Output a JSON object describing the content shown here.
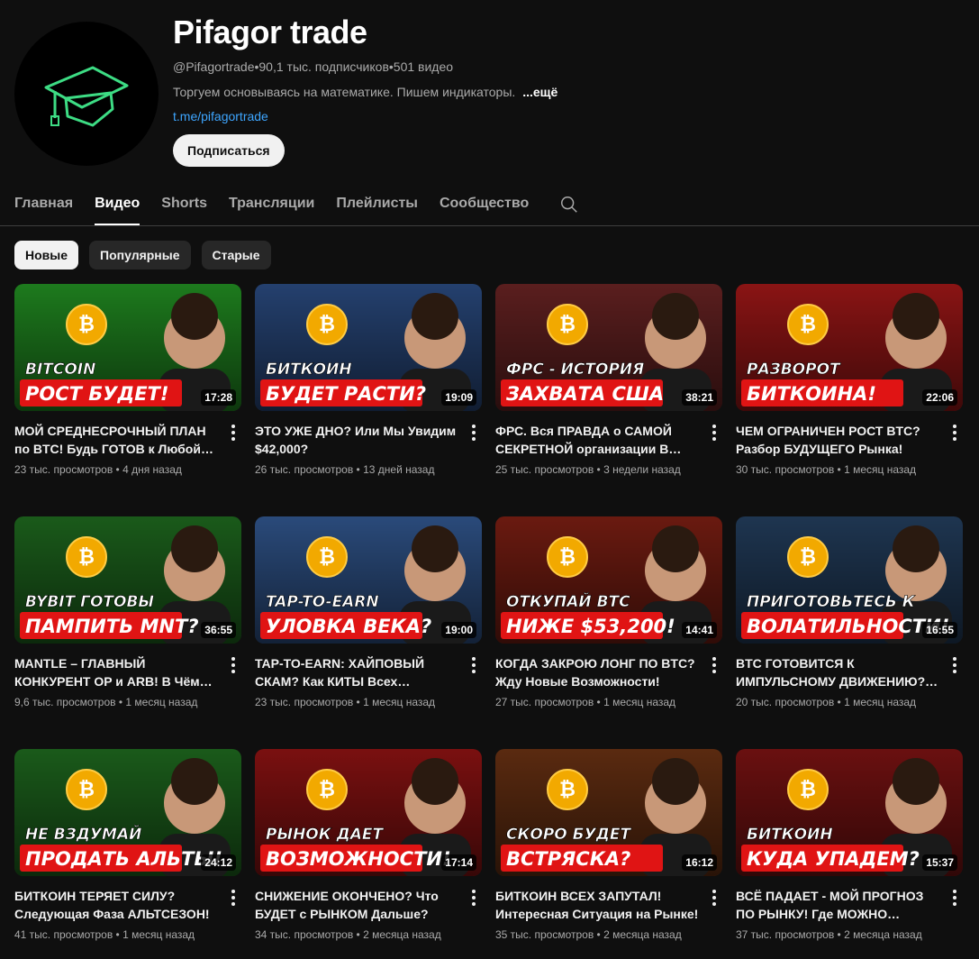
{
  "channel": {
    "title": "Pifagor trade",
    "handle": "@Pifagortrade",
    "subscribers": "90,1 тыс. подписчиков",
    "videos_count": "501 видео",
    "separator": " • ",
    "description": "Торгуем основываясь на математике. Пишем индикаторы.",
    "more_label": "...ещё",
    "link": "t.me/pifagortrade",
    "subscribe_label": "Подписаться"
  },
  "tabs": [
    {
      "label": "Главная"
    },
    {
      "label": "Видео"
    },
    {
      "label": "Shorts"
    },
    {
      "label": "Трансляции"
    },
    {
      "label": "Плейлисты"
    },
    {
      "label": "Сообщество"
    }
  ],
  "chips": [
    {
      "label": "Новые"
    },
    {
      "label": "Популярные"
    },
    {
      "label": "Старые"
    }
  ],
  "videos": [
    {
      "thumb_line1": "BITCOIN",
      "thumb_line2": "РОСТ БУДЕТ!",
      "duration": "17:28",
      "title": "МОЙ СРЕДНЕСРОЧНЫЙ ПЛАН по BTC! Будь ГОТОВ к Любой…",
      "views": "23 тыс. просмотров",
      "age": "4 дня назад",
      "color": "#1d7a1d"
    },
    {
      "thumb_line1": "БИТКОИН",
      "thumb_line2": "БУДЕТ РАСТИ?",
      "duration": "19:09",
      "title": "ЭТО УЖЕ ДНО? Или Мы Увидим $42,000?",
      "views": "26 тыс. просмотров",
      "age": "13 дней назад",
      "color": "#24406e"
    },
    {
      "thumb_line1": "ФРС - ИСТОРИЯ",
      "thumb_line2": "ЗАХВАТА США",
      "duration": "38:21",
      "title": "ФРС. Вся ПРАВДА о САМОЙ СЕКРЕТНОЙ организации В МИР…",
      "views": "25 тыс. просмотров",
      "age": "3 недели назад",
      "color": "#5a1e1e"
    },
    {
      "thumb_line1": "РАЗВОРОТ",
      "thumb_line2": "БИТКОИНА!",
      "duration": "22:06",
      "title": "ЧЕМ ОГРАНИЧЕН РОСТ BTC? Разбор БУДУЩЕГО Рынка!",
      "views": "30 тыс. просмотров",
      "age": "1 месяц назад",
      "color": "#8a1414"
    },
    {
      "thumb_line1": "BYBIT ГОТОВЫ",
      "thumb_line2": "ПАМПИТЬ MNT?",
      "duration": "36:55",
      "title": "MANTLE – ГЛАВНЫЙ КОНКУРЕНТ OP и ARB! В Чём Секрет Проекта?",
      "views": "9,6 тыс. просмотров",
      "age": "1 месяц назад",
      "color": "#1a5a1a"
    },
    {
      "thumb_line1": "TAP-TO-EARN",
      "thumb_line2": "УЛОВКА ВЕКА?",
      "duration": "19:00",
      "title": "TAP-TO-EARN: ХАЙПОВЫЙ СКАМ? Как КИТЫ Всех Засадили?",
      "views": "23 тыс. просмотров",
      "age": "1 месяц назад",
      "color": "#2a4a7a"
    },
    {
      "thumb_line1": "ОТКУПАЙ BTC",
      "thumb_line2": "НИЖЕ $53,200!",
      "duration": "14:41",
      "title": "КОГДА ЗАКРОЮ ЛОНГ ПО BTC? Жду Новые Возможности!",
      "views": "27 тыс. просмотров",
      "age": "1 месяц назад",
      "color": "#6a1a10"
    },
    {
      "thumb_line1": "ПРИГОТОВЬТЕСЬ К",
      "thumb_line2": "ВОЛАТИЛЬНОСТИ!",
      "duration": "16:55",
      "title": "BTC ГОТОВИТСЯ К ИМПУЛЬСНОМУ ДВИЖЕНИЮ? Н…",
      "views": "20 тыс. просмотров",
      "age": "1 месяц назад",
      "color": "#1e3550"
    },
    {
      "thumb_line1": "НЕ ВЗДУМАЙ",
      "thumb_line2": "ПРОДАТЬ АЛЬТЫ!",
      "duration": "24:12",
      "title": "БИТКОИН ТЕРЯЕТ СИЛУ? Следующая Фаза АЛЬТСЕЗОН!",
      "views": "41 тыс. просмотров",
      "age": "1 месяц назад",
      "color": "#1a5a1a"
    },
    {
      "thumb_line1": "РЫНОК ДАЕТ",
      "thumb_line2": "ВОЗМОЖНОСТИ!",
      "duration": "17:14",
      "title": "СНИЖЕНИЕ ОКОНЧЕНО? Что БУДЕТ с РЫНКОМ Дальше?",
      "views": "34 тыс. просмотров",
      "age": "2 месяца назад",
      "color": "#7a1010"
    },
    {
      "thumb_line1": "СКОРО БУДЕТ",
      "thumb_line2": "ВСТРЯСКА?",
      "duration": "16:12",
      "title": "БИТКОИН ВСЕХ ЗАПУТАЛ! Интересная Ситуация на Рынке!",
      "views": "35 тыс. просмотров",
      "age": "2 месяца назад",
      "color": "#5a2a10"
    },
    {
      "thumb_line1": "БИТКОИН",
      "thumb_line2": "КУДА УПАДЕМ?",
      "duration": "15:37",
      "title": "ВСЁ ПАДАЕТ - МОЙ ПРОГНОЗ ПО РЫНКУ! Где МОЖНО Откупать?",
      "views": "37 тыс. просмотров",
      "age": "2 месяца назад",
      "color": "#6a1010"
    }
  ],
  "meta_separator": " • "
}
